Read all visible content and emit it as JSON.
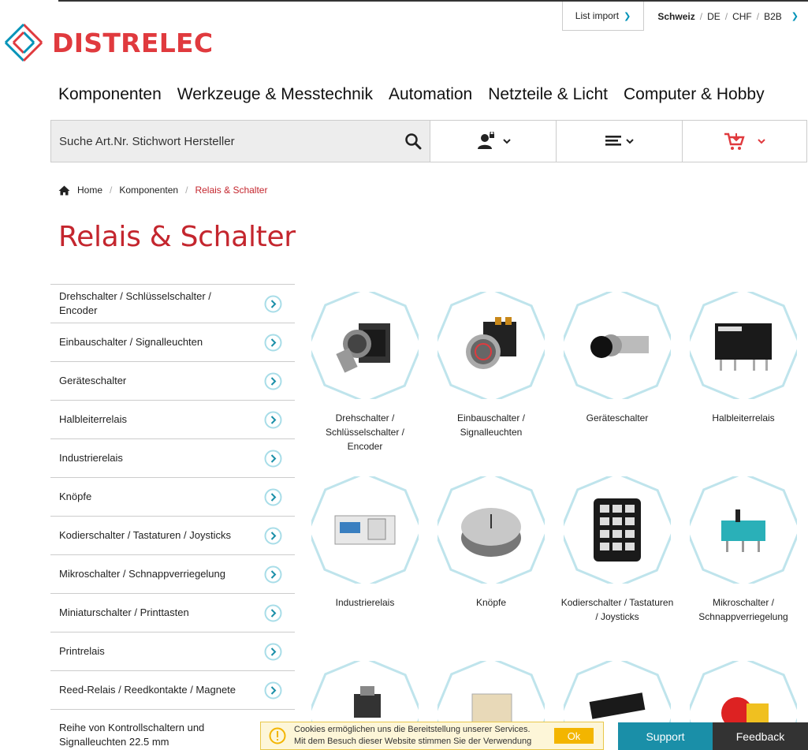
{
  "brand": {
    "name": "DISTRELEC",
    "accent": "#e03a3e",
    "teal": "#0093b8"
  },
  "util": {
    "list_import": "List import",
    "country": "Schweiz",
    "language": "DE",
    "currency": "CHF",
    "channel": "B2B"
  },
  "mainnav": [
    "Komponenten",
    "Werkzeuge & Messtechnik",
    "Automation",
    "Netzteile & Licht",
    "Computer & Hobby"
  ],
  "search": {
    "placeholder": "Suche Art.Nr. Stichwort Hersteller"
  },
  "breadcrumb": {
    "home": "Home",
    "parent": "Komponenten",
    "current": "Relais & Schalter"
  },
  "page_title": "Relais & Schalter",
  "sidebar": [
    "Drehschalter / Schlüsselschalter / Encoder",
    "Einbauschalter / Signalleuchten",
    "Geräteschalter",
    "Halbleiterrelais",
    "Industrierelais",
    "Knöpfe",
    "Kodierschalter / Tastaturen / Joysticks",
    "Mikroschalter / Schnappverriegelung",
    "Miniaturschalter / Printtasten",
    "Printrelais",
    "Reed-Relais / Reedkontakte / Magnete",
    "Reihe von Kontrollschaltern und Signalleuchten 22.5 mm"
  ],
  "tiles": [
    "Drehschalter / Schlüsselschalter / Encoder",
    "Einbauschalter / Signalleuchten",
    "Geräteschalter",
    "Halbleiterrelais",
    "Industrierelais",
    "Knöpfe",
    "Kodierschalter / Tastaturen / Joysticks",
    "Mikroschalter / Schnappverriegelung"
  ],
  "cookie": {
    "line1": "Cookies ermöglichen uns die Bereitstellung unserer Services.",
    "line2": "Mit dem Besuch dieser Website stimmen Sie der Verwendung",
    "ok": "Ok"
  },
  "support": "Support",
  "feedback": "Feedback"
}
